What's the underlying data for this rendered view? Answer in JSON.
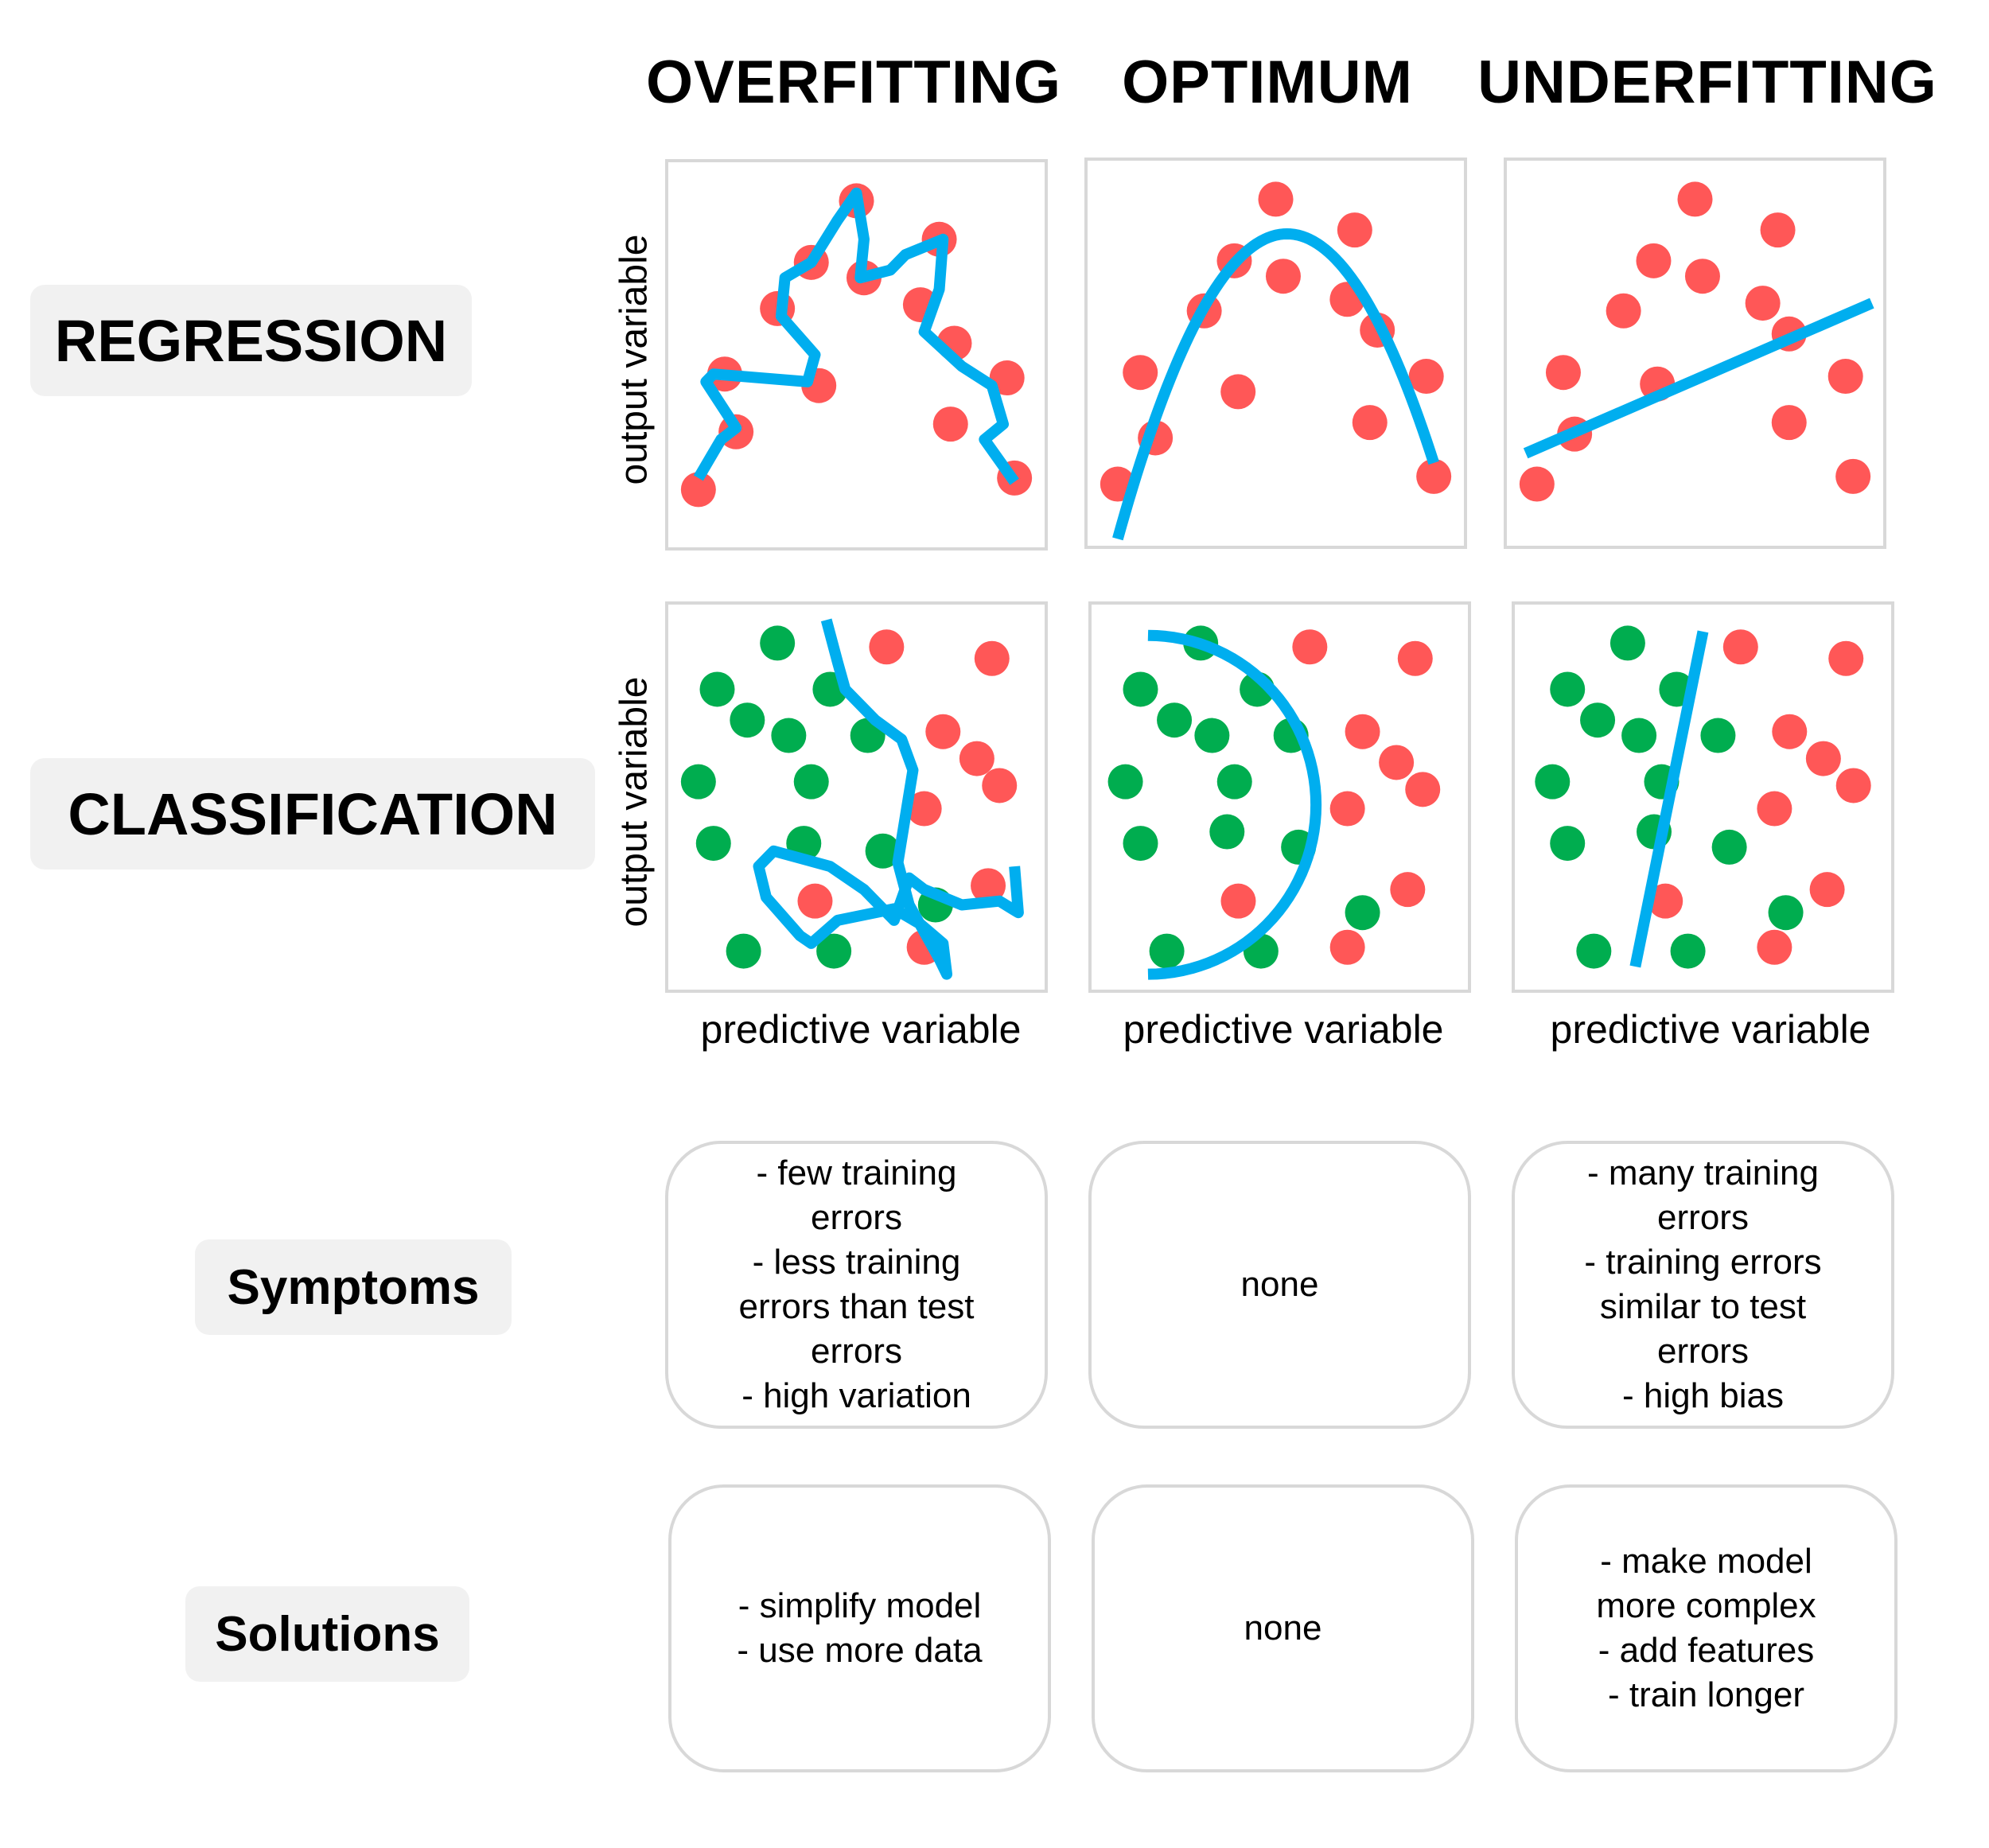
{
  "columns": [
    "OVERFITTING",
    "OPTIMUM",
    "UNDERFITTING"
  ],
  "rows": {
    "regression": "REGRESSION",
    "classification": "CLASSIFICATION",
    "symptoms": "Symptoms",
    "solutions": "Solutions"
  },
  "axes": {
    "y_label": "output variable",
    "x_label": "predictive variable"
  },
  "colors": {
    "point_red": "#ff5757",
    "point_green": "#00ad4f",
    "fit_line": "#00aeef",
    "panel_border": "#d8d8d8",
    "label_bg": "#f1f1f1"
  },
  "symptoms": [
    [
      "- few training",
      "errors",
      "- less training",
      "errors than test",
      "errors",
      "- high variation"
    ],
    [
      "none"
    ],
    [
      "- many training",
      "errors",
      "- training errors",
      "similar to test",
      "errors",
      "- high bias"
    ]
  ],
  "solutions": [
    [
      "- simplify model",
      "- use more data"
    ],
    [
      "none"
    ],
    [
      "- make model",
      "more complex",
      "- add features",
      "- train longer"
    ]
  ],
  "chart_data": [
    {
      "type": "scatter",
      "title": "Regression - Overfitting",
      "xlabel": "",
      "ylabel": "output variable",
      "xlim": [
        0,
        100
      ],
      "ylim": [
        0,
        100
      ],
      "points_red": [
        [
          8,
          15
        ],
        [
          18,
          30
        ],
        [
          15,
          45
        ],
        [
          40,
          42
        ],
        [
          38,
          74
        ],
        [
          29,
          62
        ],
        [
          50,
          90
        ],
        [
          52,
          70
        ],
        [
          72,
          80
        ],
        [
          67,
          63
        ],
        [
          76,
          53
        ],
        [
          90,
          44
        ],
        [
          75,
          32
        ],
        [
          92,
          18
        ]
      ],
      "fit": {
        "kind": "wiggly",
        "path": [
          [
            8,
            18
          ],
          [
            14,
            28
          ],
          [
            18,
            31
          ],
          [
            10,
            43
          ],
          [
            12,
            45
          ],
          [
            37,
            43
          ],
          [
            39,
            50
          ],
          [
            30,
            60
          ],
          [
            31,
            70
          ],
          [
            38,
            74
          ],
          [
            45,
            85
          ],
          [
            50,
            92
          ],
          [
            52,
            80
          ],
          [
            51,
            70
          ],
          [
            59,
            72
          ],
          [
            63,
            76
          ],
          [
            73,
            80
          ],
          [
            72,
            67
          ],
          [
            68,
            56
          ],
          [
            78,
            47
          ],
          [
            86,
            42
          ],
          [
            89,
            32
          ],
          [
            84,
            28
          ],
          [
            92,
            17
          ]
        ]
      }
    },
    {
      "type": "scatter",
      "title": "Regression - Optimum",
      "xlabel": "",
      "ylabel": "",
      "xlim": [
        0,
        100
      ],
      "ylim": [
        0,
        100
      ],
      "points_red": [
        [
          8,
          16
        ],
        [
          18,
          28
        ],
        [
          14,
          45
        ],
        [
          31,
          61
        ],
        [
          40,
          40
        ],
        [
          39,
          74
        ],
        [
          50,
          90
        ],
        [
          52,
          70
        ],
        [
          71,
          82
        ],
        [
          69,
          64
        ],
        [
          77,
          56
        ],
        [
          90,
          44
        ],
        [
          75,
          32
        ],
        [
          92,
          18
        ]
      ],
      "fit": {
        "kind": "parabola",
        "vertex": [
          53,
          81
        ],
        "roots_at_y": 12,
        "x_range": [
          8,
          92
        ]
      }
    },
    {
      "type": "scatter",
      "title": "Regression - Underfitting",
      "xlabel": "",
      "ylabel": "",
      "xlim": [
        0,
        100
      ],
      "ylim": [
        0,
        100
      ],
      "points_red": [
        [
          8,
          16
        ],
        [
          18,
          29
        ],
        [
          15,
          45
        ],
        [
          40,
          42
        ],
        [
          31,
          61
        ],
        [
          39,
          74
        ],
        [
          50,
          90
        ],
        [
          52,
          70
        ],
        [
          72,
          82
        ],
        [
          68,
          63
        ],
        [
          75,
          55
        ],
        [
          90,
          44
        ],
        [
          75,
          32
        ],
        [
          92,
          18
        ]
      ],
      "fit": {
        "kind": "line",
        "from": [
          5,
          24
        ],
        "to": [
          97,
          63
        ]
      }
    },
    {
      "type": "scatter",
      "title": "Classification - Overfitting",
      "xlabel": "predictive variable",
      "ylabel": "output variable",
      "xlim": [
        0,
        100
      ],
      "ylim": [
        0,
        100
      ],
      "points_green": [
        [
          29,
          90
        ],
        [
          13,
          78
        ],
        [
          43,
          78
        ],
        [
          21,
          70
        ],
        [
          32,
          66
        ],
        [
          53,
          66
        ],
        [
          8,
          54
        ],
        [
          38,
          54
        ],
        [
          12,
          38
        ],
        [
          36,
          38
        ],
        [
          57,
          36
        ],
        [
          71,
          22
        ],
        [
          20,
          10
        ],
        [
          44,
          10
        ]
      ],
      "points_red": [
        [
          58,
          89
        ],
        [
          86,
          86
        ],
        [
          73,
          67
        ],
        [
          82,
          60
        ],
        [
          88,
          53
        ],
        [
          68,
          47
        ],
        [
          85,
          27
        ],
        [
          39,
          23
        ],
        [
          68,
          11
        ]
      ],
      "fit": {
        "kind": "wiggly",
        "path": [
          [
            42,
            96
          ],
          [
            45,
            85
          ],
          [
            47,
            78
          ],
          [
            55,
            70
          ],
          [
            62,
            65
          ],
          [
            65,
            57
          ],
          [
            63,
            45
          ],
          [
            61,
            33
          ],
          [
            64,
            22
          ],
          [
            68,
            15
          ],
          [
            72,
            8
          ],
          [
            74,
            4
          ],
          [
            73,
            12
          ],
          [
            67,
            17
          ],
          [
            60,
            21
          ],
          [
            45,
            18
          ],
          [
            38,
            12
          ],
          [
            35,
            14
          ],
          [
            26,
            24
          ],
          [
            24,
            32
          ],
          [
            28,
            36
          ],
          [
            43,
            32
          ],
          [
            52,
            26
          ],
          [
            60,
            18
          ],
          [
            64,
            29
          ],
          [
            68,
            26
          ],
          [
            78,
            22
          ],
          [
            88,
            23
          ],
          [
            93,
            20
          ],
          [
            92,
            32
          ]
        ]
      }
    },
    {
      "type": "scatter",
      "title": "Classification - Optimum",
      "xlabel": "predictive variable",
      "ylabel": "",
      "xlim": [
        0,
        100
      ],
      "ylim": [
        0,
        100
      ],
      "points_green": [
        [
          29,
          90
        ],
        [
          13,
          78
        ],
        [
          44,
          78
        ],
        [
          22,
          70
        ],
        [
          32,
          66
        ],
        [
          53,
          66
        ],
        [
          9,
          54
        ],
        [
          38,
          54
        ],
        [
          13,
          38
        ],
        [
          36,
          41
        ],
        [
          55,
          37
        ],
        [
          72,
          20
        ],
        [
          20,
          10
        ],
        [
          45,
          10
        ]
      ],
      "points_red": [
        [
          58,
          89
        ],
        [
          86,
          86
        ],
        [
          72,
          67
        ],
        [
          81,
          59
        ],
        [
          88,
          52
        ],
        [
          68,
          47
        ],
        [
          84,
          26
        ],
        [
          39,
          23
        ],
        [
          68,
          11
        ]
      ],
      "fit": {
        "kind": "arc",
        "center": [
          15,
          48
        ],
        "radius_x": 72,
        "radius_y": 44,
        "angle_range_deg": [
          -90,
          90
        ]
      }
    },
    {
      "type": "scatter",
      "title": "Classification - Underfitting",
      "xlabel": "predictive variable",
      "ylabel": "",
      "xlim": [
        0,
        100
      ],
      "ylim": [
        0,
        100
      ],
      "points_green": [
        [
          30,
          90
        ],
        [
          14,
          78
        ],
        [
          43,
          78
        ],
        [
          22,
          70
        ],
        [
          33,
          66
        ],
        [
          54,
          66
        ],
        [
          10,
          54
        ],
        [
          39,
          54
        ],
        [
          14,
          38
        ],
        [
          37,
          41
        ],
        [
          57,
          37
        ],
        [
          72,
          20
        ],
        [
          21,
          10
        ],
        [
          46,
          10
        ]
      ],
      "points_red": [
        [
          60,
          89
        ],
        [
          88,
          86
        ],
        [
          73,
          67
        ],
        [
          82,
          60
        ],
        [
          90,
          53
        ],
        [
          69,
          47
        ],
        [
          83,
          26
        ],
        [
          40,
          23
        ],
        [
          69,
          11
        ]
      ],
      "fit": {
        "kind": "line",
        "from": [
          32,
          6
        ],
        "to": [
          50,
          93
        ]
      }
    }
  ]
}
